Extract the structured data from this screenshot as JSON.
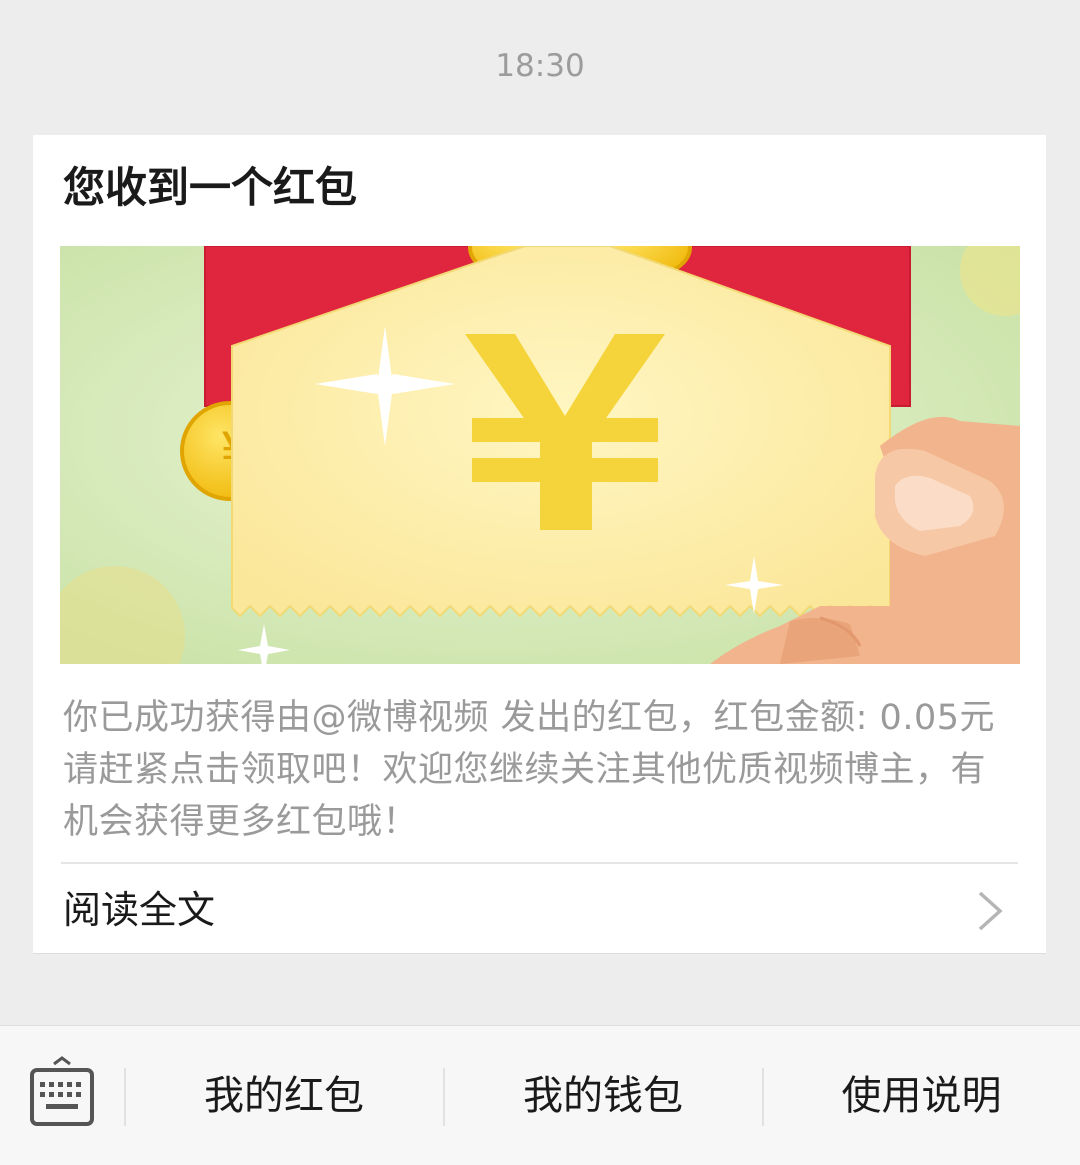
{
  "timestamp": "18:30",
  "message": {
    "title": "您收到一个红包",
    "description": "你已成功获得由@微博视频 发出的红包，红包金额: 0.05元  请赶紧点击领取吧！欢迎您继续关注其他优质视频博主，有机会获得更多红包哦！",
    "read_more_label": "阅读全文",
    "banner_icon": "red-envelope-yuan-illustration",
    "currency_symbol": "¥"
  },
  "bottom_bar": {
    "keyboard_icon": "keyboard-icon",
    "items": [
      {
        "label": "我的红包"
      },
      {
        "label": "我的钱包"
      },
      {
        "label": "使用说明"
      }
    ]
  },
  "colors": {
    "background": "#ededed",
    "banner_green": "#cfe6b0",
    "envelope_red": "#e0263e",
    "ticket_yellow": "#fbeea0",
    "coin_gold": "#f5c518",
    "hand_skin": "#f2b48d"
  }
}
